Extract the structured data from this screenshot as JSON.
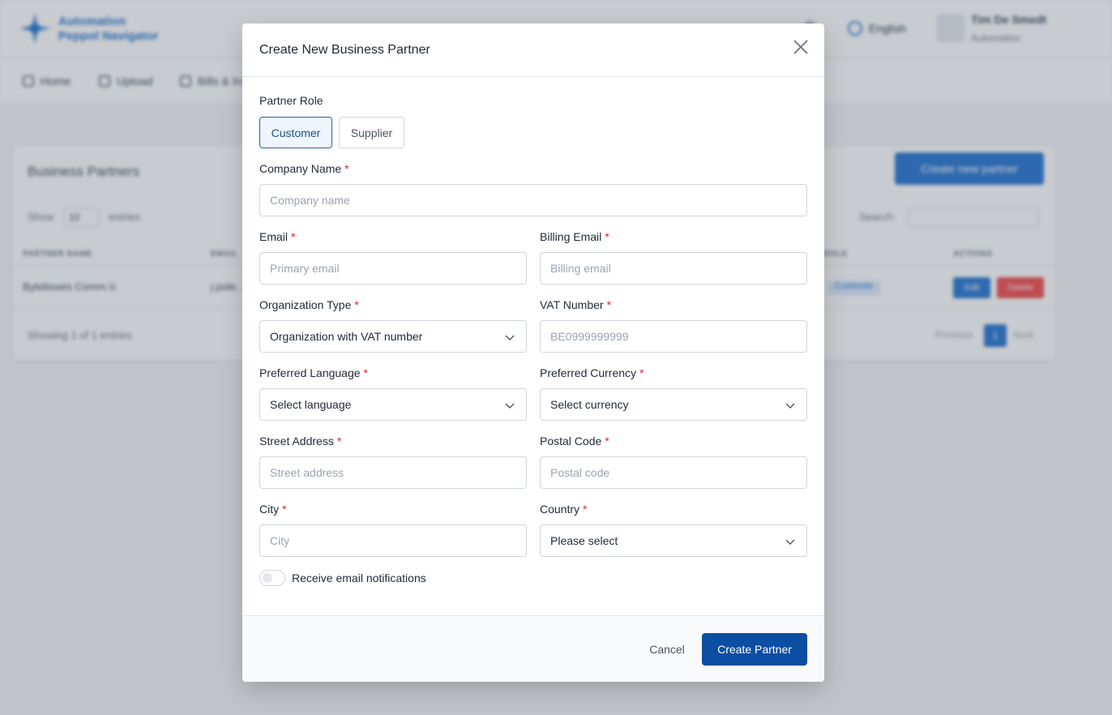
{
  "background": {
    "logo_line1": "Automation",
    "logo_line2": "Peppol Navigator",
    "language": "English",
    "user_name": "Tim De Smedt",
    "user_org": "Automation",
    "nav": [
      "Home",
      "Upload",
      "Bills & In..."
    ],
    "card_title": "Business Partners",
    "create_button": "Create new partner",
    "show_label": "Show",
    "show_value": "10",
    "entries_label": "entries",
    "search_label": "Search:",
    "columns": [
      "PARTNER NAME",
      "EMAIL",
      "ROLE",
      "ACTIONS"
    ],
    "row": {
      "name": "Byteboxes Comm.V.",
      "email": "j.pole...",
      "role": "Customer",
      "edit": "Edit",
      "delete": "Delete"
    },
    "showing": "Showing 1 of 1 entries",
    "pager_prev": "Previous",
    "pager_page": "1",
    "pager_next": "Next"
  },
  "modal": {
    "title": "Create New Business Partner",
    "partner_role_label": "Partner Role",
    "role_customer": "Customer",
    "role_supplier": "Supplier",
    "required_mark": "*",
    "fields": {
      "company_name": {
        "label": "Company Name",
        "placeholder": "Company name"
      },
      "email": {
        "label": "Email",
        "placeholder": "Primary email"
      },
      "billing_email": {
        "label": "Billing Email",
        "placeholder": "Billing email"
      },
      "org_type": {
        "label": "Organization Type",
        "value": "Organization with VAT number"
      },
      "vat": {
        "label": "VAT Number",
        "placeholder": "BE0999999999"
      },
      "language": {
        "label": "Preferred Language",
        "value": "Select language"
      },
      "currency": {
        "label": "Preferred Currency",
        "value": "Select currency"
      },
      "street": {
        "label": "Street Address",
        "placeholder": "Street address"
      },
      "postal": {
        "label": "Postal Code",
        "placeholder": "Postal code"
      },
      "city": {
        "label": "City",
        "placeholder": "City"
      },
      "country": {
        "label": "Country",
        "value": "Please select"
      }
    },
    "notifications_label": "Receive email notifications",
    "cancel": "Cancel",
    "submit": "Create Partner"
  },
  "colors": {
    "primary": "#0b4ea2",
    "required": "#dc2626",
    "overlay": "rgba(85,93,106,0.32)"
  }
}
